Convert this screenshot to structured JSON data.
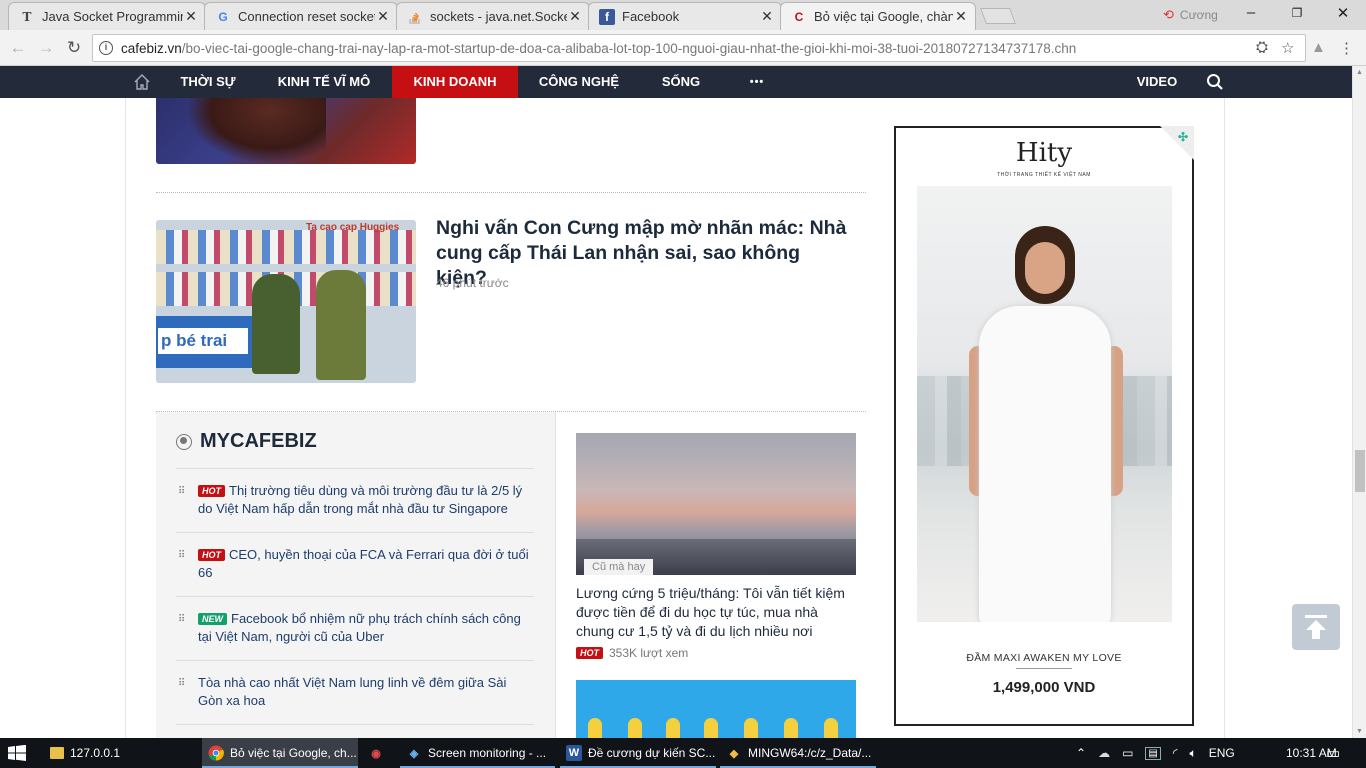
{
  "browser": {
    "tabs": [
      {
        "title": "Java Socket Programming",
        "favicon": "T",
        "favicon_color": "#444444"
      },
      {
        "title": "Connection reset socket java",
        "favicon": "G",
        "favicon_color": "#4285f4"
      },
      {
        "title": "sockets - java.net.SocketE",
        "favicon": "stack-overflow-icon",
        "favicon_color": "#f48024"
      },
      {
        "title": "Facebook",
        "favicon": "f",
        "favicon_color": "#3b5998"
      },
      {
        "title": "Bỏ việc tại Google, chàng",
        "favicon": "C",
        "favicon_color": "#c60f13"
      }
    ],
    "profile_name": "Cương",
    "url_host": "cafebiz.vn",
    "url_path": "/bo-viec-tai-google-chang-trai-nay-lap-ra-mot-startup-de-doa-ca-alibaba-lot-top-100-nguoi-giau-nhat-the-gioi-khi-moi-38-tuoi-20180727134737178.chn"
  },
  "site_nav": {
    "items": [
      "THỜI SỰ",
      "KINH TẾ VĨ MÔ",
      "KINH DOANH",
      "CÔNG NGHỆ",
      "SỐNG",
      "•••"
    ],
    "active_index": 2,
    "video": "VIDEO",
    "accent": "#c60f13",
    "bg": "#232b3a"
  },
  "articles": [
    {
      "title": "Nghi vấn Con Cưng mập mờ nhãn mác: Nhà cung cấp Thái Lan nhận sai, sao không kiện?",
      "time": "46 phút trước",
      "thumb_sign": "p bé trai",
      "thumb_top": "Ta cao cap Huggies"
    }
  ],
  "mycafebiz": {
    "title": "MYCAFEBIZ",
    "items": [
      {
        "badge": "HOT",
        "text": "Thị trường tiêu dùng và môi trường đầu tư là 2/5 lý do Việt Nam hấp dẫn trong mắt nhà đầu tư Singapore"
      },
      {
        "badge": "HOT",
        "text": "CEO, huyền thoại của FCA và Ferrari qua đời ở tuổi 66"
      },
      {
        "badge": "NEW",
        "text": "Facebook bổ nhiệm nữ phụ trách chính sách công tại Việt Nam, người cũ của Uber"
      },
      {
        "badge": "",
        "text": "Tòa nhà cao nhất Việt Nam lung linh về đêm giữa Sài Gòn xa hoa"
      }
    ]
  },
  "side_card": {
    "tag": "Cũ mà hay",
    "title": "Lương cứng 5 triệu/tháng: Tôi vẫn tiết kiệm được tiền để đi du học tự túc, mua nhà chung cư 1,5 tỷ và đi du lịch nhiều nơi",
    "badge": "HOT",
    "views": "353K lượt xem"
  },
  "ad": {
    "brand": "Hity",
    "brand_sub": "THỜI TRANG THIẾT KẾ VIỆT NAM",
    "caption": "ĐẦM MAXI AWAKEN MY LOVE",
    "price": "1,499,000 VND"
  },
  "taskbar": {
    "items": [
      {
        "label": "127.0.0.1",
        "icon": "folder-icon"
      },
      {
        "label": "Bỏ việc tại Google, ch...",
        "icon": "chrome-icon",
        "active": true
      },
      {
        "label": "",
        "icon": "app-icon"
      },
      {
        "label": "Screen monitoring - ...",
        "icon": "cube-icon"
      },
      {
        "label": "Đề cương dự kiến SC...",
        "icon": "word-icon"
      },
      {
        "label": "MINGW64:/c/z_Data/...",
        "icon": "git-icon"
      }
    ],
    "lang": "ENG",
    "time": "10:31 AM"
  }
}
